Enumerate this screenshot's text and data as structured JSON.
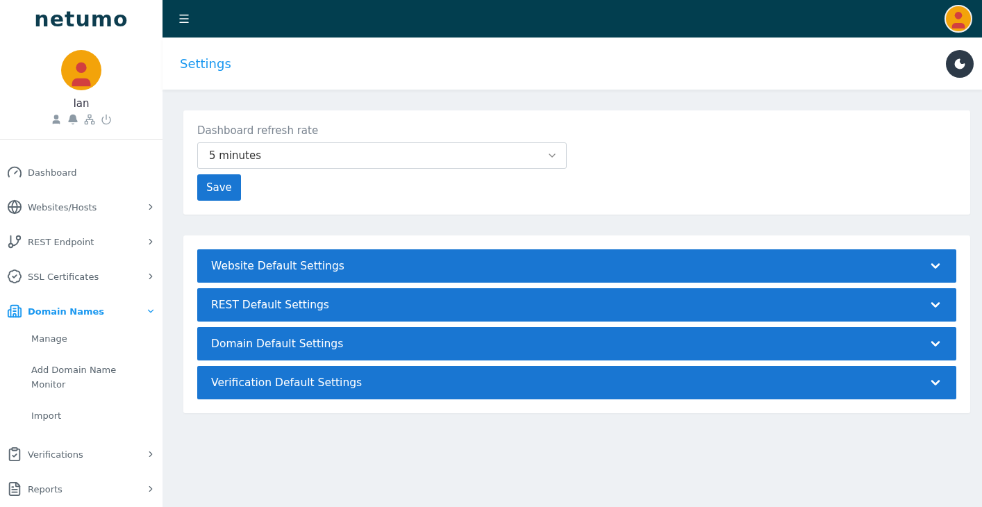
{
  "logo": "netumo",
  "user": {
    "name": "Ian"
  },
  "nav": [
    {
      "label": "Dashboard",
      "kind": "link",
      "selected": false
    },
    {
      "label": "Websites/Hosts",
      "kind": "group",
      "selected": false,
      "expanded": false
    },
    {
      "label": "REST Endpoint",
      "kind": "group",
      "selected": false,
      "expanded": false
    },
    {
      "label": "SSL Certificates",
      "kind": "group",
      "selected": false,
      "expanded": false
    },
    {
      "label": "Domain Names",
      "kind": "group",
      "selected": true,
      "expanded": true,
      "children": [
        {
          "label": "Manage"
        },
        {
          "label": "Add Domain Name Monitor"
        },
        {
          "label": "Import"
        }
      ]
    },
    {
      "label": "Verifications",
      "kind": "group",
      "selected": false,
      "expanded": false
    },
    {
      "label": "Reports",
      "kind": "group",
      "selected": false,
      "expanded": false
    }
  ],
  "page_title": "Settings",
  "refresh": {
    "label": "Dashboard refresh rate",
    "value": "5 minutes",
    "button": "Save"
  },
  "sections": [
    {
      "title": "Website Default Settings",
      "expanded": false
    },
    {
      "title": "REST Default Settings",
      "expanded": false
    },
    {
      "title": "Domain Default Settings",
      "expanded": false
    },
    {
      "title": "Verification Default Settings",
      "expanded": false
    }
  ]
}
